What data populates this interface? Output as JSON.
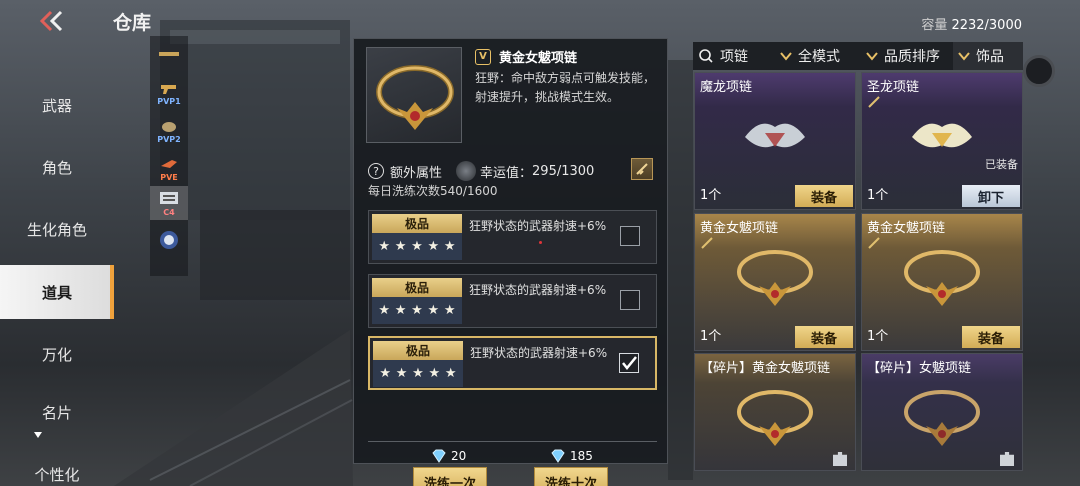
{
  "header": {
    "title": "仓库",
    "capacity_label": "容量",
    "capacity_value": "2232/3000"
  },
  "left_nav": {
    "items": [
      {
        "label": "武器"
      },
      {
        "label": "角色"
      },
      {
        "label": "生化角色"
      },
      {
        "label": "道具",
        "active": true
      },
      {
        "label": "万化"
      },
      {
        "label": "名片"
      },
      {
        "label": "个性化"
      }
    ]
  },
  "sub_strip": {
    "items": [
      {
        "icon": "rifle-icon",
        "tag": ""
      },
      {
        "icon": "pistol-icon",
        "tag": "PVP1"
      },
      {
        "icon": "grenade-icon",
        "tag": "PVP2"
      },
      {
        "icon": "bomb-icon",
        "tag": "PVE"
      },
      {
        "icon": "c4-icon",
        "tag": "C4",
        "active": true
      },
      {
        "icon": "helmet-icon",
        "tag": ""
      }
    ]
  },
  "detail": {
    "name": "黄金女魃项链",
    "quality_glyph": "V",
    "description": "狂野：命中敌方弱点可触发技能，射速提升，挑战模式生效。",
    "extra_attr_label": "额外属性",
    "luck_label": "幸运值：",
    "luck_value": "295/1300",
    "daily_label": "每日洗练次数",
    "daily_value": "540/1600",
    "attributes": [
      {
        "grade": "极品",
        "stars": 5,
        "text": "狂野状态的武器射速+6%",
        "checked": false
      },
      {
        "grade": "极品",
        "stars": 5,
        "text": "狂野状态的武器射速+6%",
        "checked": false
      },
      {
        "grade": "极品",
        "stars": 5,
        "text": "狂野状态的武器射速+6%",
        "checked": true
      }
    ],
    "wash_once": {
      "cost": "20",
      "label": "洗练一次"
    },
    "wash_ten": {
      "cost": "185",
      "label": "洗练十次"
    }
  },
  "filters": {
    "search": "项链",
    "mode": "全模式",
    "sort": "品质排序",
    "category": "饰品"
  },
  "cards": [
    {
      "name": "魔龙项链",
      "count": "1个",
      "action": "装备",
      "style": "purple",
      "equipped": ""
    },
    {
      "name": "圣龙项链",
      "count": "1个",
      "action": "卸下",
      "style": "purple",
      "equipped": "已装备"
    },
    {
      "name": "黄金女魃项链",
      "count": "1个",
      "action": "装备",
      "style": "gold",
      "equipped": ""
    },
    {
      "name": "黄金女魃项链",
      "count": "1个",
      "action": "装备",
      "style": "gold",
      "equipped": ""
    },
    {
      "name": "【碎片】黄金女魃项链",
      "count": "",
      "action": "",
      "style": "gold-dark",
      "equipped": ""
    },
    {
      "name": "【碎片】女魃项链",
      "count": "",
      "action": "",
      "style": "purple-dark",
      "equipped": ""
    }
  ],
  "colors": {
    "gold_accent": "#d8b766",
    "active_nav_bar": "#f0a23c"
  }
}
